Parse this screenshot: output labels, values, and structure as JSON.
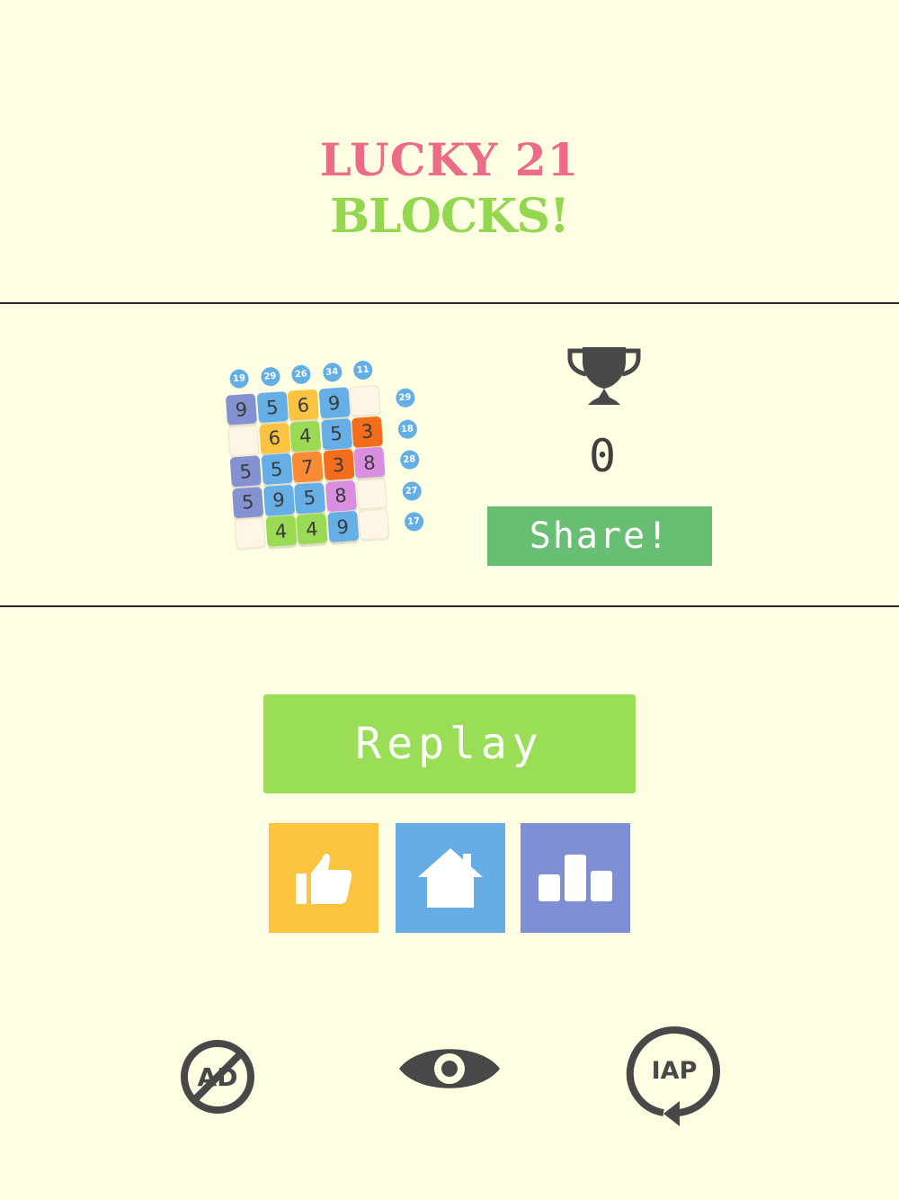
{
  "header": {
    "title_line1": "LUCKY 21",
    "title_line2": "BLOCKS!"
  },
  "colors": {
    "background": "#fefee3",
    "title_pink": "#ec6b86",
    "title_green": "#93d64f",
    "share": "#68bf74",
    "replay": "#9ade58",
    "like": "#fcc33f",
    "home": "#66ade6",
    "leaderboard": "#7f8fd4",
    "icon_dark": "#484848"
  },
  "board": {
    "column_sums": [
      "19",
      "29",
      "26",
      "34",
      "11"
    ],
    "row_sums": [
      "29",
      "18",
      "28",
      "27",
      "17"
    ],
    "rows": [
      [
        {
          "v": "9",
          "c": "#8592d1"
        },
        {
          "v": "5",
          "c": "#65aee6"
        },
        {
          "v": "6",
          "c": "#fbc33f"
        },
        {
          "v": "9",
          "c": "#65aee6"
        },
        {
          "v": "",
          "c": ""
        }
      ],
      [
        {
          "v": "",
          "c": ""
        },
        {
          "v": "6",
          "c": "#fbc33f"
        },
        {
          "v": "4",
          "c": "#9ada55"
        },
        {
          "v": "5",
          "c": "#65aee6"
        },
        {
          "v": "3",
          "c": "#f46d1d"
        }
      ],
      [
        {
          "v": "5",
          "c": "#8592d1"
        },
        {
          "v": "5",
          "c": "#65aee6"
        },
        {
          "v": "7",
          "c": "#fb8a35"
        },
        {
          "v": "3",
          "c": "#f46d1d"
        },
        {
          "v": "8",
          "c": "#d98ee0"
        }
      ],
      [
        {
          "v": "5",
          "c": "#8592d1"
        },
        {
          "v": "9",
          "c": "#65aee6"
        },
        {
          "v": "5",
          "c": "#65aee6"
        },
        {
          "v": "8",
          "c": "#d98ee0"
        },
        {
          "v": "",
          "c": ""
        }
      ],
      [
        {
          "v": "",
          "c": ""
        },
        {
          "v": "4",
          "c": "#9ada55"
        },
        {
          "v": "4",
          "c": "#9ada55"
        },
        {
          "v": "9",
          "c": "#65aee6"
        },
        {
          "v": "",
          "c": ""
        }
      ]
    ]
  },
  "score": {
    "best": "0",
    "trophy_icon": "trophy-icon"
  },
  "buttons": {
    "share": "Share!",
    "replay": "Replay",
    "like_icon": "thumbs-up-icon",
    "home_icon": "home-icon",
    "leaderboard_icon": "leaderboard-icon"
  },
  "bottom": {
    "no_ads_label": "AD",
    "iap_label": "IAP",
    "eye_icon": "eye-icon"
  }
}
